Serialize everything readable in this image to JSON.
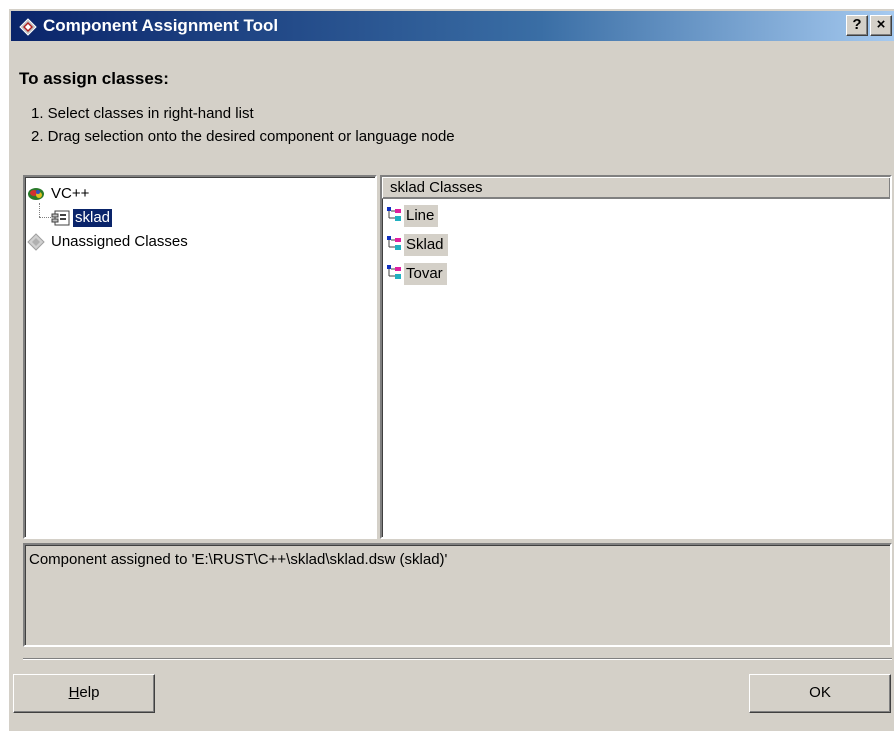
{
  "window": {
    "title": "Component Assignment Tool",
    "help_button": "?",
    "close_button": "×"
  },
  "instructions": {
    "heading": "To assign classes:",
    "step1": "1. Select classes in right-hand list",
    "step2": "2. Drag selection onto the desired component or language node"
  },
  "tree": {
    "items": [
      {
        "label": "VC++",
        "icon": "vc-language-icon"
      },
      {
        "label": "sklad",
        "icon": "component-icon",
        "selected": true
      },
      {
        "label": "Unassigned Classes",
        "icon": "unassigned-icon"
      }
    ]
  },
  "class_list": {
    "header": "sklad Classes",
    "items": [
      {
        "label": "Line",
        "icon": "class-icon"
      },
      {
        "label": "Sklad",
        "icon": "class-icon"
      },
      {
        "label": "Tovar",
        "icon": "class-icon"
      }
    ]
  },
  "status": {
    "text": "Component assigned to 'E:\\RUST\\C++\\sklad\\sklad.dsw (sklad)'"
  },
  "buttons": {
    "help_prefix": "H",
    "help_rest": "elp",
    "ok": "OK"
  },
  "colors": {
    "title_gradient_start": "#0a246a",
    "title_gradient_end": "#a6caf0",
    "dialog_bg": "#d4d0c8",
    "selection": "#0a246a"
  }
}
